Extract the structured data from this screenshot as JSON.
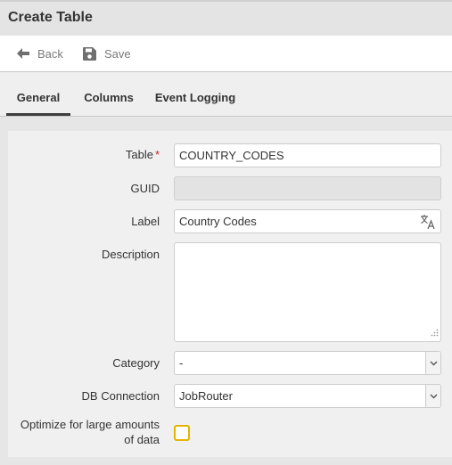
{
  "header": {
    "title": "Create Table"
  },
  "toolbar": {
    "back_label": "Back",
    "save_label": "Save"
  },
  "tabs": [
    {
      "label": "General",
      "active": true
    },
    {
      "label": "Columns",
      "active": false
    },
    {
      "label": "Event Logging",
      "active": false
    }
  ],
  "form": {
    "table": {
      "label": "Table",
      "required_mark": "*",
      "value": "COUNTRY_CODES"
    },
    "guid": {
      "label": "GUID",
      "value": ""
    },
    "label_field": {
      "label": "Label",
      "value": "Country Codes"
    },
    "description": {
      "label": "Description",
      "value": ""
    },
    "category": {
      "label": "Category",
      "value": "-"
    },
    "db_connection": {
      "label": "DB Connection",
      "value": "JobRouter"
    },
    "optimize": {
      "label": "Optimize for large amounts of data",
      "checked": false
    }
  },
  "colors": {
    "checkbox_border": "#e5b400",
    "required_mark": "#cc2222",
    "active_tab_underline": "#3d3d3d"
  },
  "icons": {
    "back": "arrow-left-icon",
    "save": "floppy-disk-icon",
    "translate": "translate-icon",
    "select": "chevron-down-icon"
  }
}
